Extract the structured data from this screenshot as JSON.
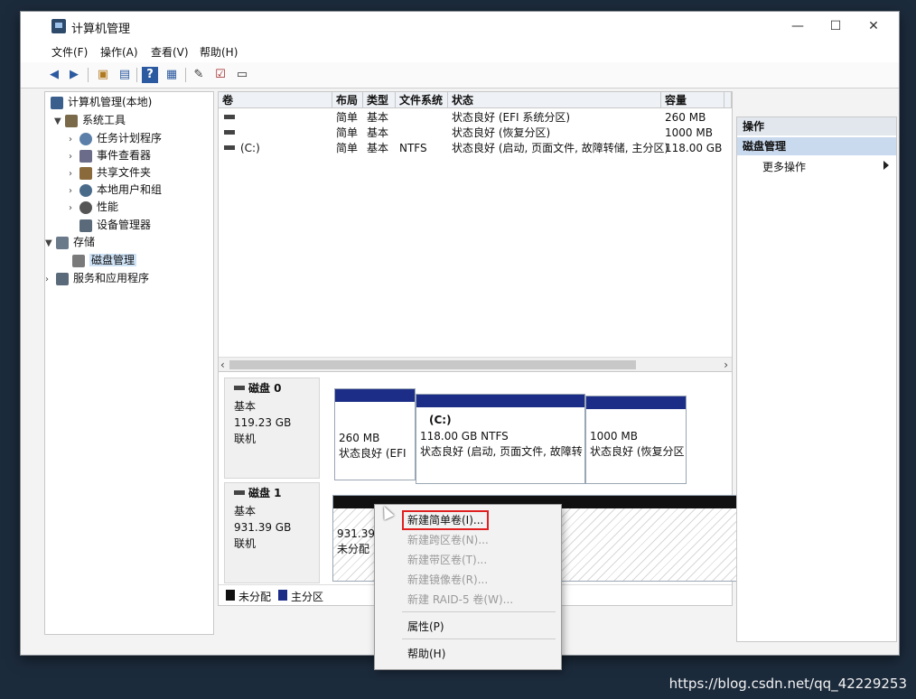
{
  "window": {
    "title": "计算机管理",
    "controls": {
      "minimize": "—",
      "maximize": "☐",
      "close": "✕"
    }
  },
  "menubar": [
    "文件(F)",
    "操作(A)",
    "查看(V)",
    "帮助(H)"
  ],
  "toolbar_icons": [
    "back-arrow-icon",
    "forward-arrow-icon",
    "folder-up-icon",
    "console-tree-icon",
    "help-icon",
    "properties-icon",
    "comment-icon",
    "checklist-icon",
    "view-icon"
  ],
  "tree": {
    "root": "计算机管理(本地)",
    "items": [
      {
        "label": "系统工具",
        "level": 1,
        "expanded": true
      },
      {
        "label": "任务计划程序",
        "level": 2
      },
      {
        "label": "事件查看器",
        "level": 2
      },
      {
        "label": "共享文件夹",
        "level": 2
      },
      {
        "label": "本地用户和组",
        "level": 2
      },
      {
        "label": "性能",
        "level": 2
      },
      {
        "label": "设备管理器",
        "level": 2
      },
      {
        "label": "存储",
        "level": 1,
        "expanded": true
      },
      {
        "label": "磁盘管理",
        "level": 2,
        "selected": true
      },
      {
        "label": "服务和应用程序",
        "level": 1
      }
    ]
  },
  "volume_table": {
    "columns": [
      "卷",
      "布局",
      "类型",
      "文件系统",
      "状态",
      "容量"
    ],
    "rows": [
      {
        "volume": "",
        "layout": "简单",
        "type": "基本",
        "fs": "",
        "status": "状态良好 (EFI 系统分区)",
        "capacity": "260 MB"
      },
      {
        "volume": "",
        "layout": "简单",
        "type": "基本",
        "fs": "",
        "status": "状态良好 (恢复分区)",
        "capacity": "1000 MB"
      },
      {
        "volume": "(C:)",
        "layout": "简单",
        "type": "基本",
        "fs": "NTFS",
        "status": "状态良好 (启动, 页面文件, 故障转储, 主分区)",
        "capacity": "118.00 GB"
      }
    ]
  },
  "disks": [
    {
      "name": "磁盘 0",
      "kind": "基本",
      "size": "119.23 GB",
      "state": "联机",
      "partitions": [
        {
          "label": "",
          "size": "260 MB",
          "status": "状态良好 (EFI"
        },
        {
          "label": "(C:)",
          "size": "118.00 GB NTFS",
          "status": "状态良好 (启动, 页面文件, 故障转"
        },
        {
          "label": "",
          "size": "1000 MB",
          "status": "状态良好 (恢复分区"
        }
      ]
    },
    {
      "name": "磁盘 1",
      "kind": "基本",
      "size": "931.39 GB",
      "state": "联机",
      "unallocated": {
        "size": "931.39 GB",
        "status": "未分配"
      }
    }
  ],
  "legend": [
    {
      "label": "未分配",
      "color": "#111111"
    },
    {
      "label": "主分区",
      "color": "#1c2d88"
    }
  ],
  "actions": {
    "header": "操作",
    "section": "磁盘管理",
    "item": "更多操作"
  },
  "context_menu": {
    "items": [
      {
        "label": "新建简单卷(I)...",
        "enabled": true
      },
      {
        "label": "新建跨区卷(N)...",
        "enabled": false
      },
      {
        "label": "新建带区卷(T)...",
        "enabled": false
      },
      {
        "label": "新建镜像卷(R)...",
        "enabled": false
      },
      {
        "label": "新建 RAID-5 卷(W)...",
        "enabled": false
      },
      {
        "label": "属性(P)",
        "enabled": true
      },
      {
        "label": "帮助(H)",
        "enabled": true
      }
    ]
  },
  "watermark": "https://blog.csdn.net/qq_42229253",
  "colors": {
    "primary_partition": "#1c2d88",
    "unallocated": "#111111",
    "highlight": "#e02020"
  }
}
